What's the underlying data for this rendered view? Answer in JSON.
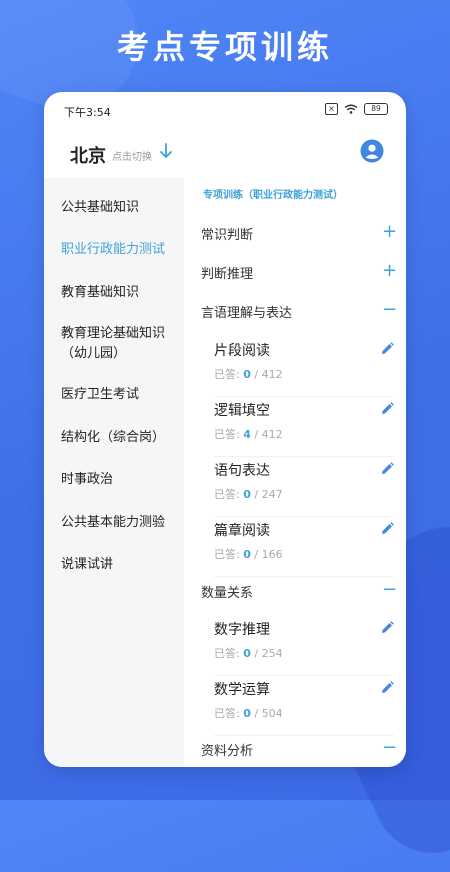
{
  "headline": "考点专项训练",
  "status": {
    "time": "下午3:54",
    "battery": "89"
  },
  "header": {
    "city": "北京",
    "switch_text": "点击切换"
  },
  "sidebar": {
    "items": [
      {
        "label": "公共基础知识",
        "active": false
      },
      {
        "label": "职业行政能力测试",
        "active": true
      },
      {
        "label": "教育基础知识",
        "active": false
      },
      {
        "label": "教育理论基础知识\n（幼儿园）",
        "active": false
      },
      {
        "label": "医疗卫生考试",
        "active": false
      },
      {
        "label": "结构化（综合岗）",
        "active": false
      },
      {
        "label": "时事政治",
        "active": false
      },
      {
        "label": "公共基本能力测验",
        "active": false
      },
      {
        "label": "说课试讲",
        "active": false
      }
    ]
  },
  "content": {
    "section_title": "专项训练（职业行政能力测试）",
    "answered_label": "已答:",
    "categories": [
      {
        "label": "常识判断",
        "state": "+"
      },
      {
        "label": "判断推理",
        "state": "+"
      },
      {
        "label": "言语理解与表达",
        "state": "−",
        "subs": [
          {
            "name": "片段阅读",
            "done": "0",
            "total": "/ 412"
          },
          {
            "name": "逻辑填空",
            "done": "4",
            "total": "/ 412"
          },
          {
            "name": "语句表达",
            "done": "0",
            "total": "/ 247"
          },
          {
            "name": "篇章阅读",
            "done": "0",
            "total": "/ 166"
          }
        ]
      },
      {
        "label": "数量关系",
        "state": "−",
        "subs": [
          {
            "name": "数字推理",
            "done": "0",
            "total": "/ 254"
          },
          {
            "name": "数学运算",
            "done": "0",
            "total": "/ 504"
          }
        ]
      },
      {
        "label": "资料分析",
        "state": "−"
      }
    ]
  },
  "colors": {
    "accent": "#3fa2d9",
    "background": "#4a7cf0"
  }
}
